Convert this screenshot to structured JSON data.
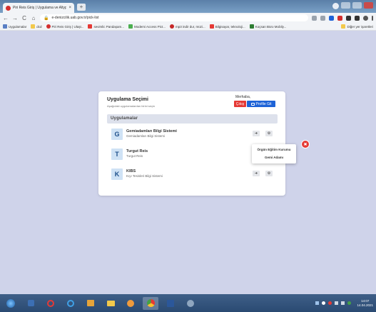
{
  "browser": {
    "tab_title": "Piri Reis Giriş | Uygulama ve Altyp...",
    "tab_close": "×",
    "new_tab": "+",
    "nav_back": "←",
    "nav_forward": "→",
    "nav_reload": "C",
    "nav_home": "⌂",
    "url": "e-denizcilik.uab.gov.tr/pick-list"
  },
  "bookmarks": [
    {
      "label": "Uygulamalar",
      "color": "#5a7fc4"
    },
    {
      "label": "dcd",
      "color": "#f2c94c"
    },
    {
      "label": "Piri Reis Giriş | Ulaşt...",
      "color": "#d32f2f"
    },
    {
      "label": "sevimlic Pandaşam...",
      "color": "#e53935"
    },
    {
      "label": "Modemi Access Pict...",
      "color": "#4caf50"
    },
    {
      "label": "mp3 indir dur, müzi...",
      "color": "#c62828"
    },
    {
      "label": "Bilgisayar, teknoloji...",
      "color": "#e53935"
    },
    {
      "label": "Koçsan Büro Mobily...",
      "color": "#2e7d32"
    }
  ],
  "bookmarks_other": "Diğer yer işaretleri",
  "page": {
    "title": "Uygulama Seçimi",
    "subtitle": "Aşağıdaki uygulamalardan birini seçin",
    "greeting": "Merhaba,",
    "exit_label": "Çıkış",
    "profile_label": "Profile Git",
    "section_title": "Uygulamalar"
  },
  "apps": [
    {
      "letter": "G",
      "name": "Gemiadamları Bilgi Sistemi",
      "desc": "Gemiadamları Bilgi Sistemi"
    },
    {
      "letter": "T",
      "name": "Turgut Reis",
      "desc": "Turgut Reis"
    },
    {
      "letter": "K",
      "name": "KIBS",
      "desc": "Kıyı Tesisleri Bilgi Sistemi"
    }
  ],
  "dropdown": {
    "items": [
      "Örgün Eğitim Kurumu",
      "Gemi Adamı"
    ],
    "badge": "✖"
  },
  "taskbar": {
    "time": "14:07",
    "date": "14.04.2021"
  },
  "colors": {
    "background": "#cfd3ea",
    "exit": "#e53935",
    "profile": "#1e63d7",
    "section": "#dde1ec"
  }
}
